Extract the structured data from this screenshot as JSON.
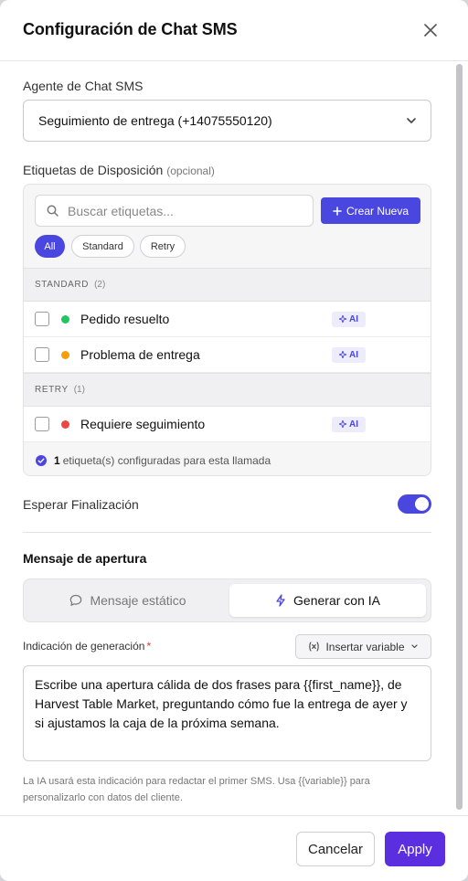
{
  "modal": {
    "title": "Configuración de Chat SMS"
  },
  "agent": {
    "label": "Agente de Chat SMS",
    "selected": "Seguimiento de entrega (+14075550120)"
  },
  "tags": {
    "label": "Etiquetas de Disposición",
    "optional": "(opcional)",
    "search_placeholder": "Buscar etiquetas...",
    "create_label": "Crear Nueva",
    "filters": [
      "All",
      "Standard",
      "Retry"
    ],
    "sections": [
      {
        "name": "STANDARD",
        "count": "(2)",
        "items": [
          {
            "name": "Pedido resuelto",
            "color": "#22c55e",
            "badge": "AI"
          },
          {
            "name": "Problema de entrega",
            "color": "#f59e0b",
            "badge": "AI"
          }
        ]
      },
      {
        "name": "RETRY",
        "count": "(1)",
        "items": [
          {
            "name": "Requiere seguimiento",
            "color": "#ef4444",
            "badge": "AI"
          }
        ]
      }
    ],
    "summary_count": "1",
    "summary_text": "etiqueta(s) configuradas para esta llamada"
  },
  "wait": {
    "label": "Esperar Finalización",
    "enabled": true
  },
  "opening": {
    "heading": "Mensaje de apertura",
    "static_label": "Mensaje estático",
    "ai_label": "Generar con IA",
    "prompt_label": "Indicación de generación",
    "required_mark": "*",
    "insert_variable": "Insertar variable",
    "prompt_value": "Escribe una apertura cálida de dos frases para {{first_name}}, de Harvest Table Market, preguntando cómo fue la entrega de ayer y si ajustamos la caja de la próxima semana.",
    "help": "La IA usará esta indicación para redactar el primer SMS. Usa {{variable}} para personalizarlo con datos del cliente."
  },
  "footer": {
    "cancel": "Cancelar",
    "apply": "Apply"
  },
  "colors": {
    "accent": "#4a46e0",
    "apply": "#5b2ee0"
  }
}
